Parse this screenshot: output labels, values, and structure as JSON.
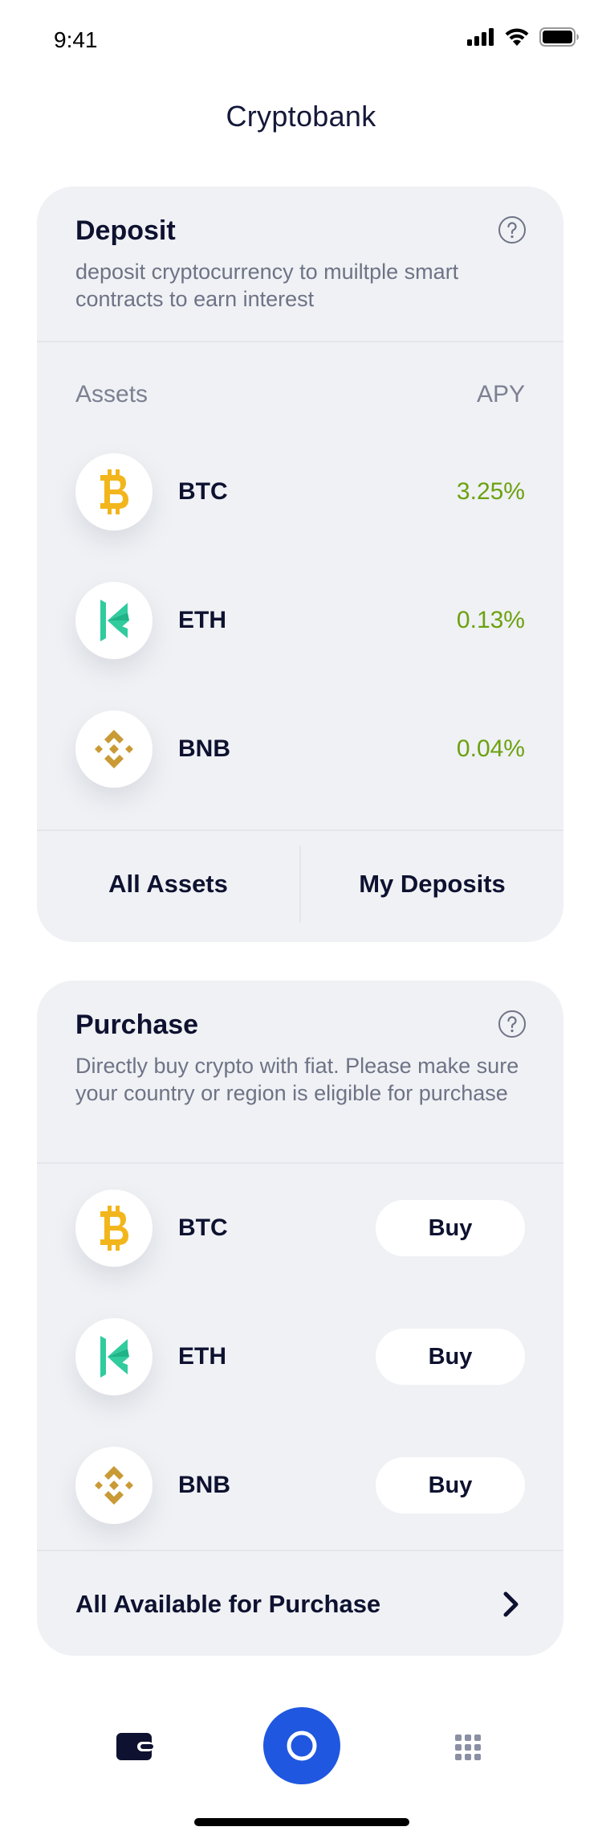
{
  "status_bar": {
    "time": "9:41"
  },
  "app": {
    "title": "Cryptobank"
  },
  "deposit": {
    "title": "Deposit",
    "description": "deposit cryptocurrency to muiltple smart contracts to earn interest",
    "assets_label": "Assets",
    "apy_label": "APY",
    "rows": [
      {
        "symbol": "BTC",
        "apy": "3.25%",
        "icon": "bitcoin-icon"
      },
      {
        "symbol": "ETH",
        "apy": "0.13%",
        "icon": "kyber-icon"
      },
      {
        "symbol": "BNB",
        "apy": "0.04%",
        "icon": "binance-icon"
      }
    ],
    "all_assets_label": "All Assets",
    "my_deposits_label": "My Deposits"
  },
  "purchase": {
    "title": "Purchase",
    "description": "Directly buy crypto with fiat. Please make sure your country or region is eligible for purchase",
    "rows": [
      {
        "symbol": "BTC",
        "button": "Buy",
        "icon": "bitcoin-icon"
      },
      {
        "symbol": "ETH",
        "button": "Buy",
        "icon": "kyber-icon"
      },
      {
        "symbol": "BNB",
        "button": "Buy",
        "icon": "binance-icon"
      }
    ],
    "all_available_label": "All Available for Purchase"
  },
  "colors": {
    "accent": "#1f57e0",
    "apy_green": "#6ca10f",
    "card_bg": "#eff1f4",
    "bitcoin": "#f2b61c",
    "kyber": "#31cb9e",
    "binance": "#c99a35"
  },
  "tabbar": {
    "items": [
      "wallet-icon",
      "home-circle-icon",
      "grid-icon"
    ]
  }
}
